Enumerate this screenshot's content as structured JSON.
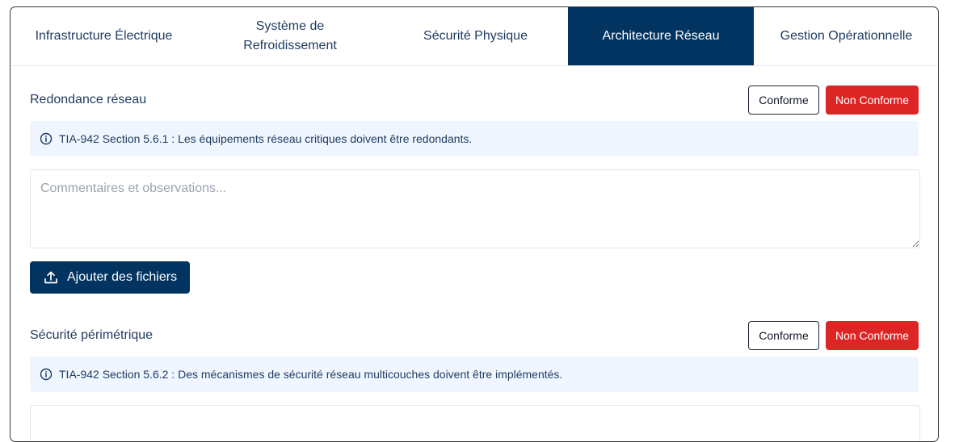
{
  "tabs": [
    {
      "label": "Infrastructure Électrique"
    },
    {
      "label": "Système de Refroidissement"
    },
    {
      "label": "Sécurité Physique"
    },
    {
      "label": "Architecture Réseau",
      "active": true
    },
    {
      "label": "Gestion Opérationnelle"
    }
  ],
  "sections": [
    {
      "title": "Redondance réseau",
      "conforme_label": "Conforme",
      "non_conforme_label": "Non Conforme",
      "info_text": "TIA-942 Section 5.6.1 : Les équipements réseau critiques doivent être redondants.",
      "comments_placeholder": "Commentaires et observations...",
      "upload_label": "Ajouter des fichiers"
    },
    {
      "title": "Sécurité périmétrique",
      "conforme_label": "Conforme",
      "non_conforme_label": "Non Conforme",
      "info_text": "TIA-942 Section 5.6.2 : Des mécanismes de sécurité réseau multicouches doivent être implémentés."
    }
  ],
  "colors": {
    "primary": "#023462",
    "danger": "#dc2626",
    "info_bg": "#eff6ff"
  },
  "icons": {
    "info": "info-circle-icon",
    "upload": "upload-icon"
  }
}
